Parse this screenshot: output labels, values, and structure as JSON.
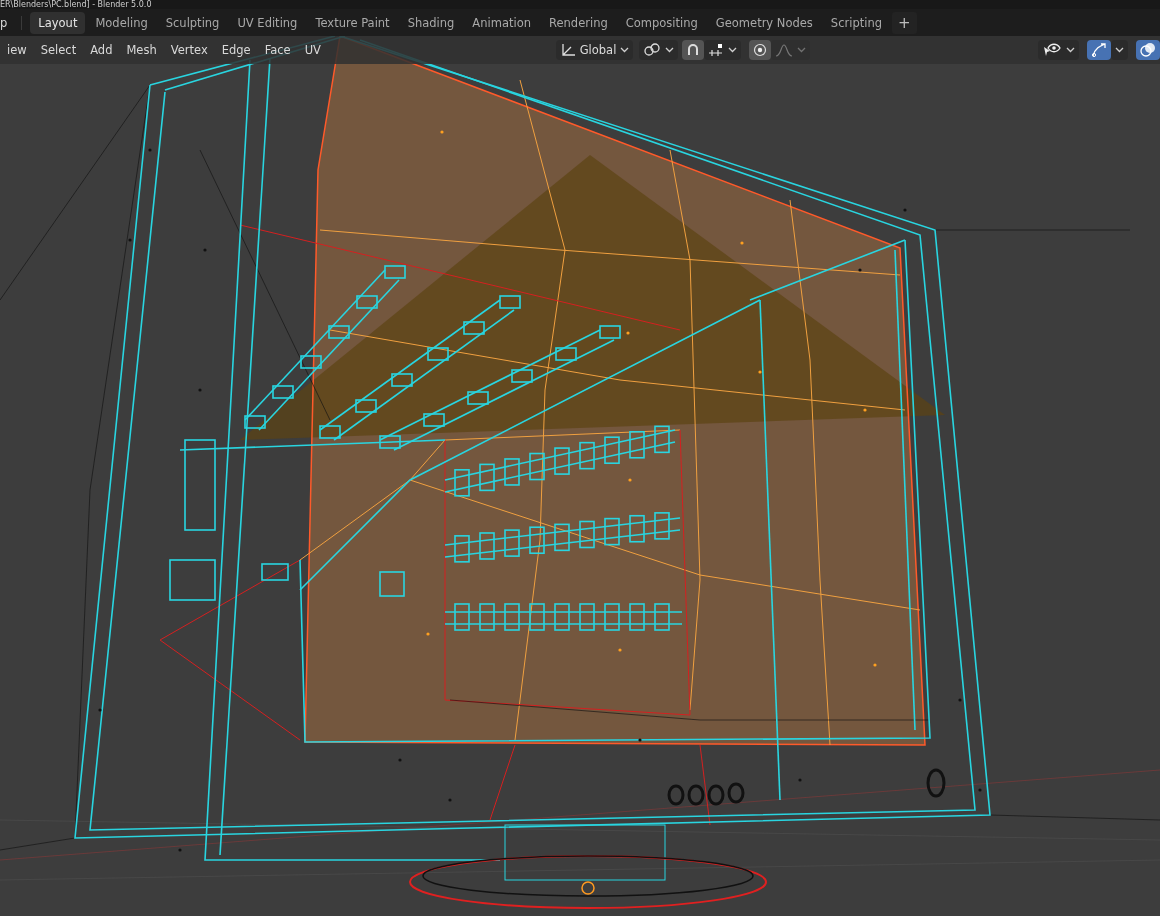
{
  "window": {
    "title": "ER\\Blenders\\PC.blend] - Blender 5.0.0"
  },
  "topbar": {
    "menu_cut": "p",
    "tabs": [
      {
        "label": "Layout",
        "selected": true
      },
      {
        "label": "Modeling",
        "selected": false
      },
      {
        "label": "Sculpting",
        "selected": false
      },
      {
        "label": "UV Editing",
        "selected": false
      },
      {
        "label": "Texture Paint",
        "selected": false
      },
      {
        "label": "Shading",
        "selected": false
      },
      {
        "label": "Animation",
        "selected": false
      },
      {
        "label": "Rendering",
        "selected": false
      },
      {
        "label": "Compositing",
        "selected": false
      },
      {
        "label": "Geometry Nodes",
        "selected": false
      },
      {
        "label": "Scripting",
        "selected": false
      }
    ],
    "add_tab": "+"
  },
  "header": {
    "menus": [
      "iew",
      "Select",
      "Add",
      "Mesh",
      "Vertex",
      "Edge",
      "Face",
      "UV"
    ],
    "transform_orientation": "Global",
    "snap": {
      "on": true
    },
    "proportional_editing": {
      "on": true
    },
    "falloff": {
      "disabled": true
    },
    "gizmos": {
      "on": true
    },
    "overlays": {
      "on": true
    }
  }
}
